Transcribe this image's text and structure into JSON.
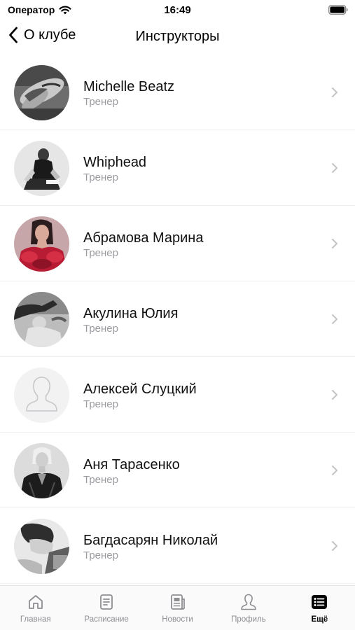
{
  "status_bar": {
    "carrier": "Оператор",
    "time": "16:49"
  },
  "nav": {
    "back_label": "О клубе",
    "title": "Инструкторы"
  },
  "instructors": [
    {
      "name": "Michelle Beatz",
      "role": "Тренер",
      "avatar": "photo-bw-tattoo"
    },
    {
      "name": "Whiphead",
      "role": "Тренер",
      "avatar": "photo-bw-seated"
    },
    {
      "name": "Абрамова Марина",
      "role": "Тренер",
      "avatar": "photo-color-red-dress"
    },
    {
      "name": "Акулина Юлия",
      "role": "Тренер",
      "avatar": "photo-bw-lying"
    },
    {
      "name": "Алексей Слуцкий",
      "role": "Тренер",
      "avatar": "placeholder-person"
    },
    {
      "name": "Аня Тарасенко",
      "role": "Тренер",
      "avatar": "photo-bw-portrait"
    },
    {
      "name": "Багдасарян Николай",
      "role": "Тренер",
      "avatar": "photo-bw-profile"
    }
  ],
  "tabs": [
    {
      "label": "Главная",
      "icon": "home-icon",
      "active": false
    },
    {
      "label": "Расписание",
      "icon": "schedule-icon",
      "active": false
    },
    {
      "label": "Новости",
      "icon": "news-icon",
      "active": false
    },
    {
      "label": "Профиль",
      "icon": "profile-icon",
      "active": false
    },
    {
      "label": "Ещё",
      "icon": "more-icon",
      "active": true
    }
  ],
  "colors": {
    "secondary_text": "#9b9ba1",
    "tab_inactive": "#8e8e93",
    "tab_active": "#000000"
  }
}
